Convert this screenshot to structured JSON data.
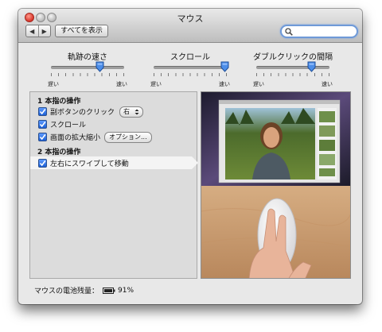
{
  "window": {
    "title": "マウス"
  },
  "toolbar": {
    "back_icon": "left-arrow-icon",
    "forward_icon": "right-arrow-icon",
    "back_glyph": "◀",
    "forward_glyph": "▶",
    "show_all_label": "すべてを表示",
    "search_placeholder": "",
    "search_value": ""
  },
  "sliders": [
    {
      "label": "軌跡の速さ",
      "min_label": "遅い",
      "max_label": "速い",
      "value": 0.67
    },
    {
      "label": "スクロール",
      "min_label": "遅い",
      "max_label": "速い",
      "value": 0.97
    },
    {
      "label": "ダブルクリックの間隔",
      "min_label": "遅い",
      "max_label": "速い",
      "value": 0.75
    }
  ],
  "one_finger": {
    "title": "1 本指の操作",
    "items": [
      {
        "label": "副ボタンのクリック",
        "checked": true,
        "popup_value": "右"
      },
      {
        "label": "スクロール",
        "checked": true
      },
      {
        "label": "画面の拡大縮小",
        "checked": true,
        "button_label": "オプション..."
      }
    ]
  },
  "two_finger": {
    "title": "2 本指の操作",
    "items": [
      {
        "label": "左右にスワイプして移動",
        "checked": true
      }
    ]
  },
  "battery": {
    "label": "マウスの電池残量：",
    "value": "91%"
  },
  "colors": {
    "accent": "#3a7ce8",
    "checkbox": "#1b5fd6"
  }
}
